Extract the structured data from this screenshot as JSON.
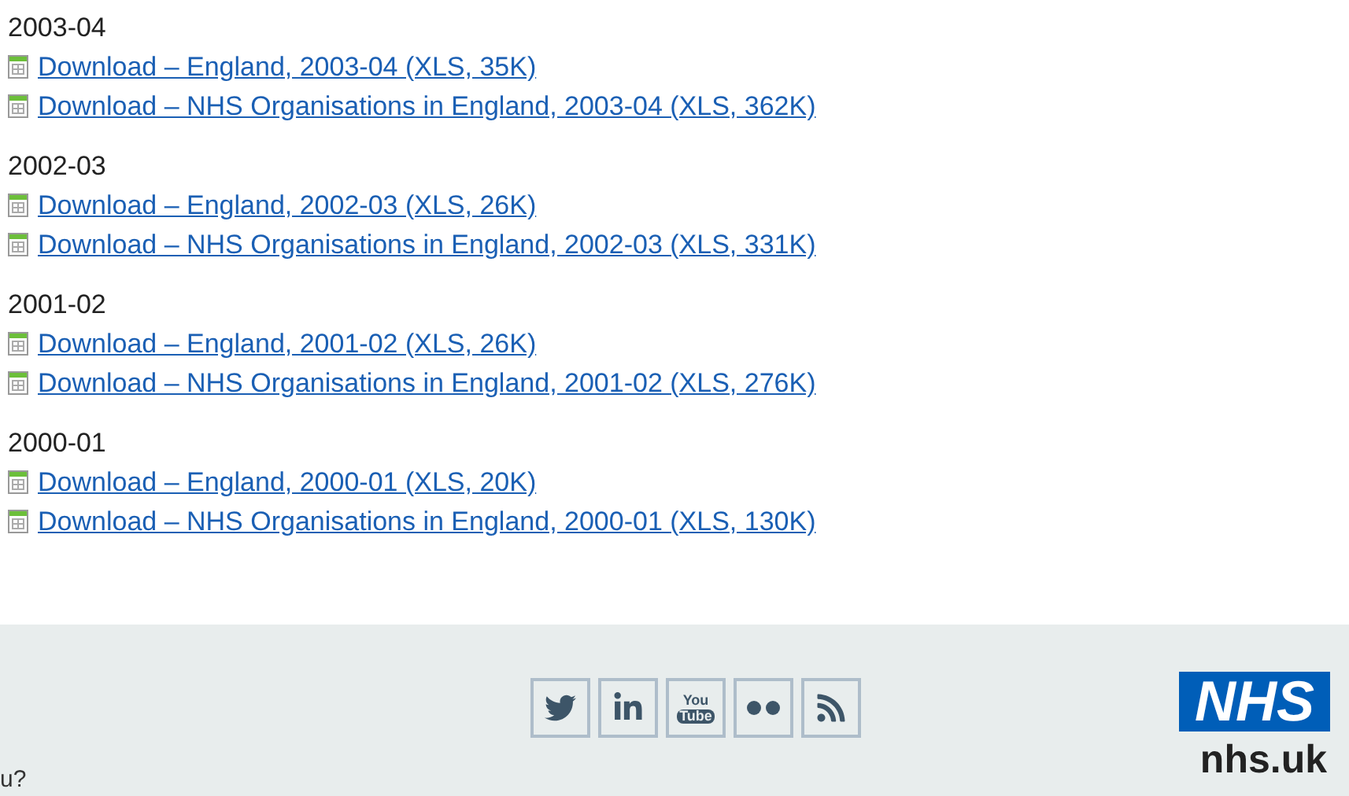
{
  "sections": [
    {
      "year": "2003-04",
      "links": [
        "Download – England, 2003-04 (XLS, 35K)",
        "Download – NHS Organisations in England, 2003-04 (XLS, 362K)"
      ]
    },
    {
      "year": "2002-03",
      "links": [
        "Download – England, 2002-03 (XLS, 26K)",
        "Download – NHS Organisations in England, 2002-03 (XLS, 331K)"
      ]
    },
    {
      "year": "2001-02",
      "links": [
        "Download – England, 2001-02 (XLS, 26K)",
        "Download – NHS Organisations in England, 2001-02 (XLS, 276K)"
      ]
    },
    {
      "year": "2000-01",
      "links": [
        "Download – England, 2000-01 (XLS, 20K)",
        "Download – NHS Organisations in England, 2000-01 (XLS, 130K)"
      ]
    }
  ],
  "footer": {
    "left_text": "u?",
    "social": [
      {
        "kind": "twitter"
      },
      {
        "kind": "linkedin"
      },
      {
        "kind": "youtube",
        "top": "You",
        "bottom": "Tube"
      },
      {
        "kind": "flickr"
      },
      {
        "kind": "rss"
      }
    ],
    "logo": "NHS",
    "site": "nhs.uk"
  }
}
